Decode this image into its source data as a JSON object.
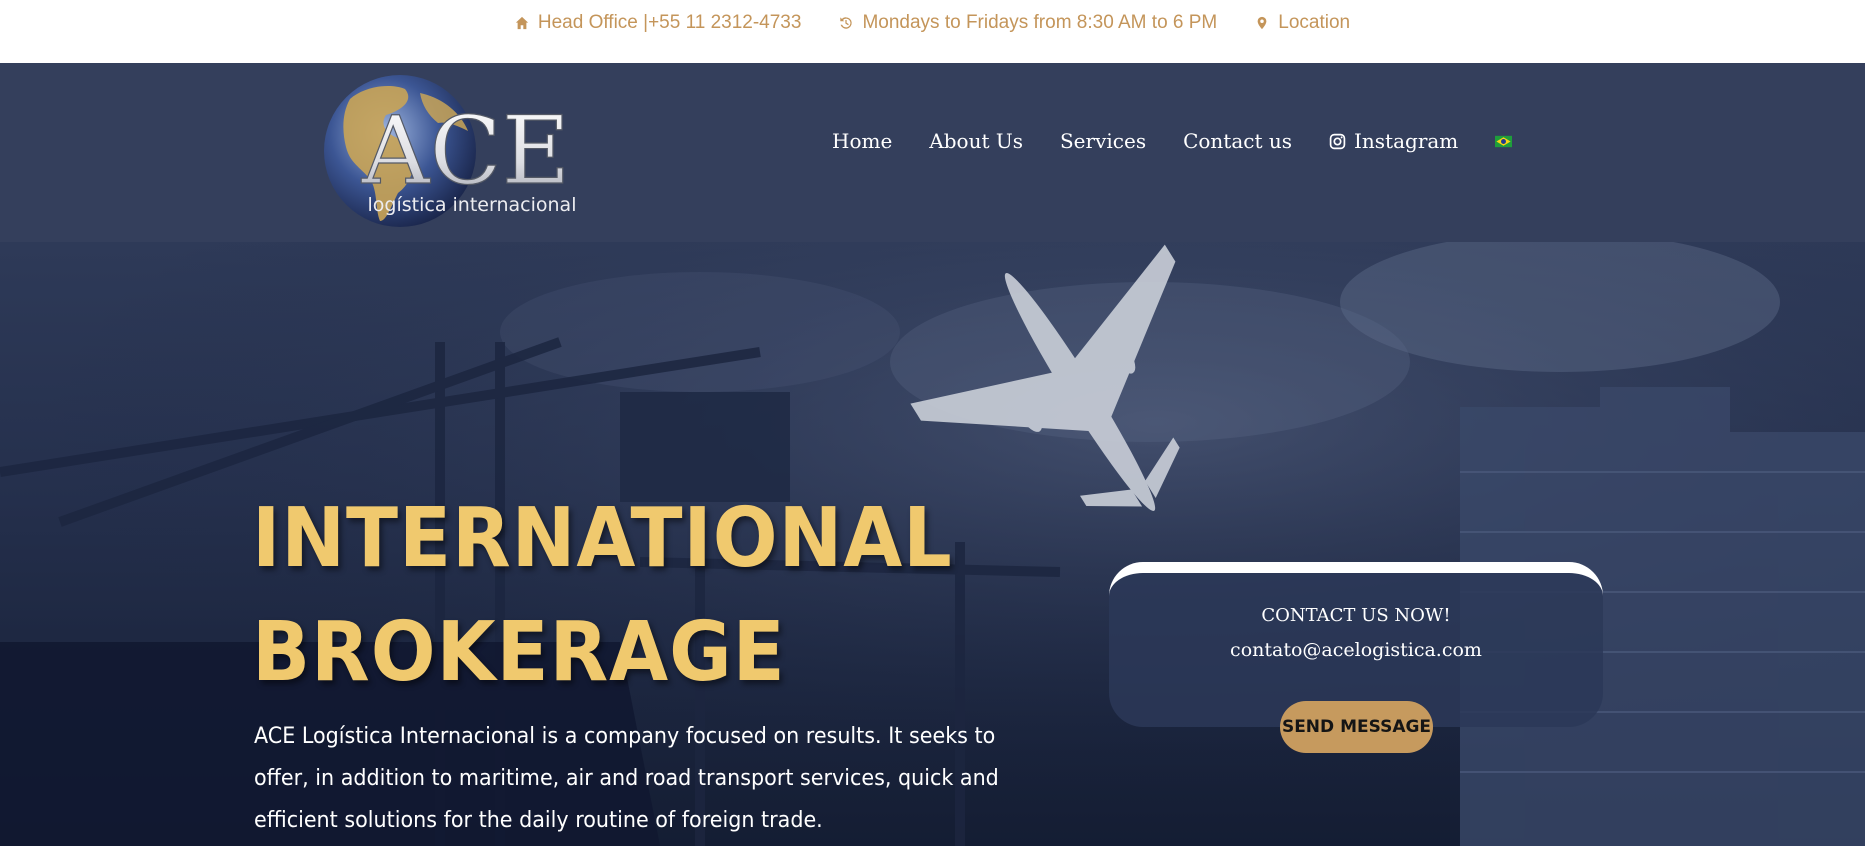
{
  "topbar": {
    "office": "Head Office |+55 11 2312-4733",
    "hours": "Mondays to Fridays from 8:30 AM to 6 PM",
    "location": "Location",
    "icons": [
      "home-icon",
      "history-icon",
      "location-pin-icon"
    ]
  },
  "logo": {
    "main": "ACE",
    "sub": "logística internacional"
  },
  "nav": {
    "items": [
      "Home",
      "About Us",
      "Services",
      "Contact us",
      "Instagram"
    ],
    "language": "brazil-flag-icon"
  },
  "hero": {
    "headline_1": "INTERNATIONAL",
    "headline_2": "BROKERAGE",
    "description": "ACE Logística Internacional is a company focused on results. It seeks to offer, in addition to maritime, air and road transport services, quick and efficient solutions for the daily routine of foreign trade."
  },
  "contact": {
    "title": "CONTACT US NOW!",
    "email": "contato@acelogistica.com",
    "button": "SEND MESSAGE"
  },
  "colors": {
    "gold": "#c4955a",
    "header_bg": "#343f5c",
    "headline": "#f0c96e",
    "button": "#c69a5e"
  }
}
